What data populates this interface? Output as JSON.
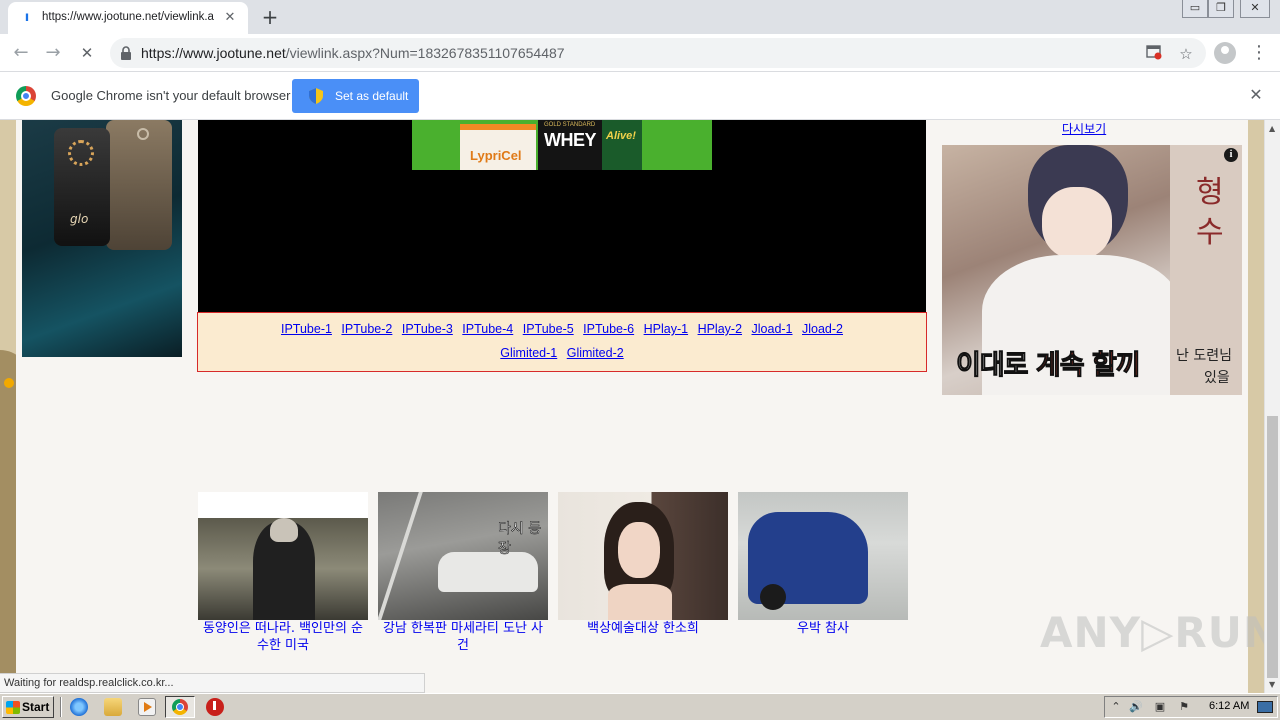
{
  "browser": {
    "tab_title": "https://www.jootune.net/viewlink.a",
    "tab_close_glyph": "✕",
    "new_tab_glyph": "+",
    "url_host": "https://www.jootune.net",
    "url_path": "/viewlink.aspx?Num=1832678351107654487",
    "back_glyph": "←",
    "forward_glyph": "→",
    "reload_glyph": "✕",
    "menu_glyph": "⋮",
    "bookmark_glyph": "☆",
    "window_controls": [
      "▭",
      "❐",
      "✕"
    ]
  },
  "infobar": {
    "message": "Google Chrome isn't your default browser",
    "button_label": "Set as default",
    "close_glyph": "✕"
  },
  "page": {
    "replay_link": "다시보기",
    "banner_ad": {
      "product1": "LypriCel",
      "product2_small": "GOLD STANDARD",
      "product2": "WHEY",
      "product3": "Alive!"
    },
    "left_ad": {
      "brand": "glo"
    },
    "player_links_row1": [
      "IPTube-1",
      "IPTube-2",
      "IPTube-3",
      "IPTube-4",
      "IPTube-5",
      "IPTube-6",
      "HPlay-1",
      "HPlay-2",
      "Jload-1",
      "Jload-2"
    ],
    "player_links_row2": [
      "Glimited-1",
      "Glimited-2"
    ],
    "right_ad": {
      "caption_white": "이대로 ",
      "caption_red": "계속 할끼",
      "side_char1": "형",
      "side_char2": "수",
      "side_line1": "난 도련님",
      "side_line2": "있을",
      "info_glyph": "i"
    },
    "thumbnails": [
      {
        "caption": "동양인은 떠나라. 백인만의 순수한 미국",
        "overlay": ""
      },
      {
        "caption": "강남 한복판 마세라티 도난 사건",
        "overlay": "다시 등장"
      },
      {
        "caption": "백상예술대상 한소희",
        "overlay": ""
      },
      {
        "caption": "우박 참사",
        "overlay": ""
      }
    ],
    "watermark": "ANY▷RUN"
  },
  "status_bubble": "Waiting for realdsp.realclick.co.kr...",
  "taskbar": {
    "start_label": "Start",
    "clock": "6:12 AM"
  },
  "colors": {
    "link": "#0000ee",
    "links_box_bg": "#fbebd0",
    "links_box_border": "#d72a2a",
    "set_default_button": "#4a8ff7"
  }
}
